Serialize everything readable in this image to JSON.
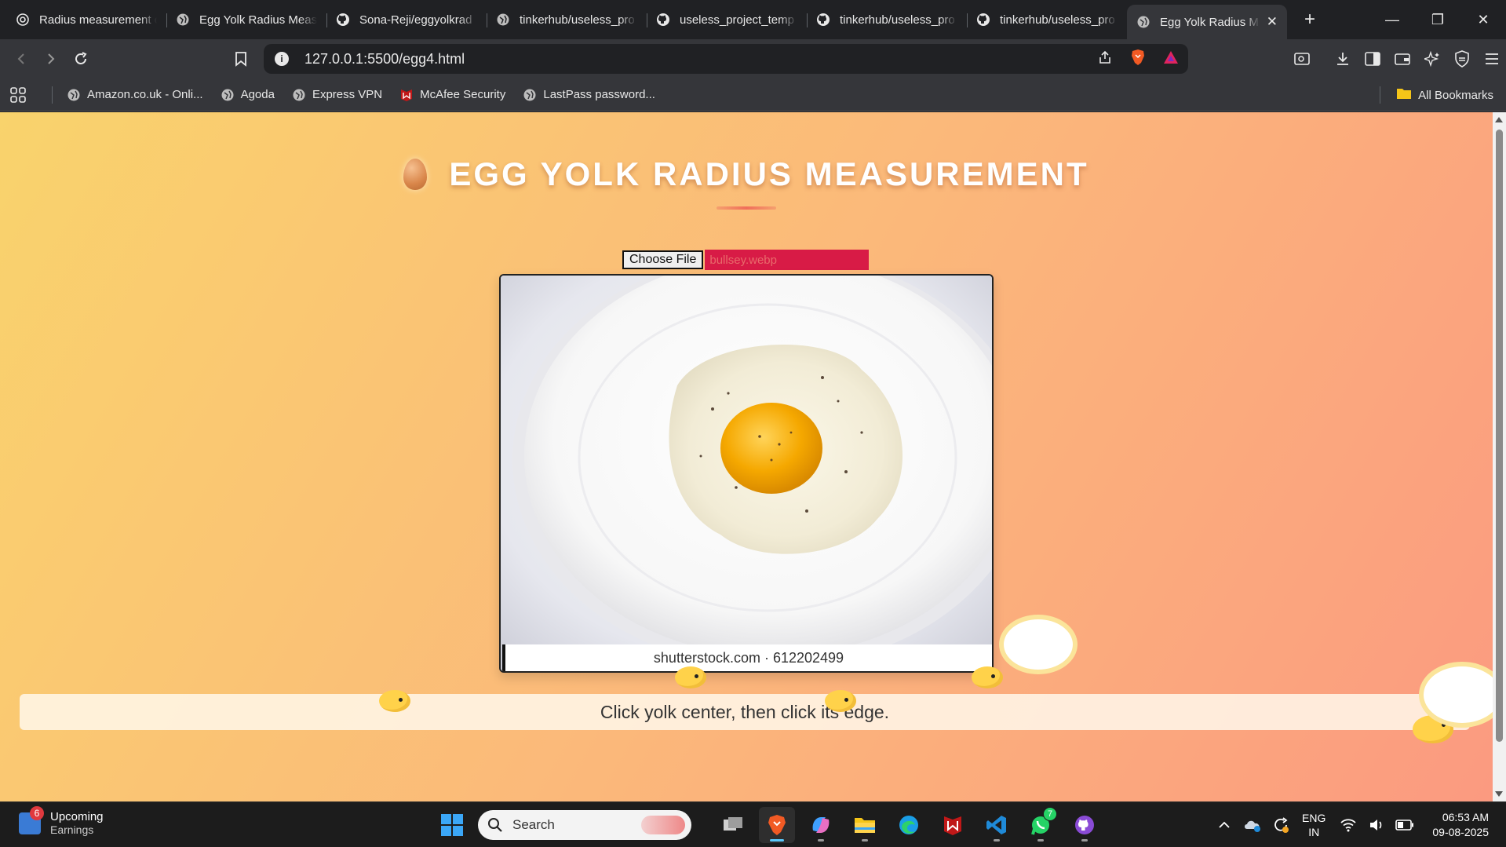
{
  "browser": {
    "tabs": [
      {
        "title": "Radius measurement c",
        "icon": "openai-icon"
      },
      {
        "title": "Egg Yolk Radius Meas",
        "icon": "globe-icon"
      },
      {
        "title": "Sona-Reji/eggyolkrad",
        "icon": "github-icon"
      },
      {
        "title": "tinkerhub/useless_pro",
        "icon": "globe-icon"
      },
      {
        "title": "useless_project_temp",
        "icon": "github-icon"
      },
      {
        "title": "tinkerhub/useless_pro",
        "icon": "github-icon"
      },
      {
        "title": "tinkerhub/useless_pro",
        "icon": "github-icon"
      },
      {
        "title": "Egg Yolk Radius M",
        "icon": "globe-icon",
        "active": true
      }
    ],
    "url": "127.0.0.1:5500/egg4.html",
    "bookmarks": [
      {
        "label": "Amazon.co.uk - Onli...",
        "icon": "globe-icon"
      },
      {
        "label": "Agoda",
        "icon": "globe-icon"
      },
      {
        "label": "Express VPN",
        "icon": "globe-icon"
      },
      {
        "label": "McAfee Security",
        "icon": "mcafee-icon"
      },
      {
        "label": "LastPass password...",
        "icon": "globe-icon"
      }
    ],
    "all_bookmarks": "All Bookmarks"
  },
  "page": {
    "title": "EGG YOLK RADIUS MEASUREMENT",
    "choose_file": "Choose File",
    "file_name": "bullsey.webp",
    "watermark": "shutterstock.com · 612202499",
    "status": "Click yolk center, then click its edge."
  },
  "taskbar": {
    "widget_badge": "6",
    "widget_line1": "Upcoming",
    "widget_line2": "Earnings",
    "search_placeholder": "Search",
    "whatsapp_badge": "7",
    "lang_line1": "ENG",
    "lang_line2": "IN",
    "time": "06:53 AM",
    "date": "09-08-2025"
  },
  "colors": {
    "page_gradient_start": "#f9d36c",
    "page_gradient_end": "#fb9a80",
    "file_name_bg": "#d81b46",
    "yolk": "#f5a800"
  }
}
